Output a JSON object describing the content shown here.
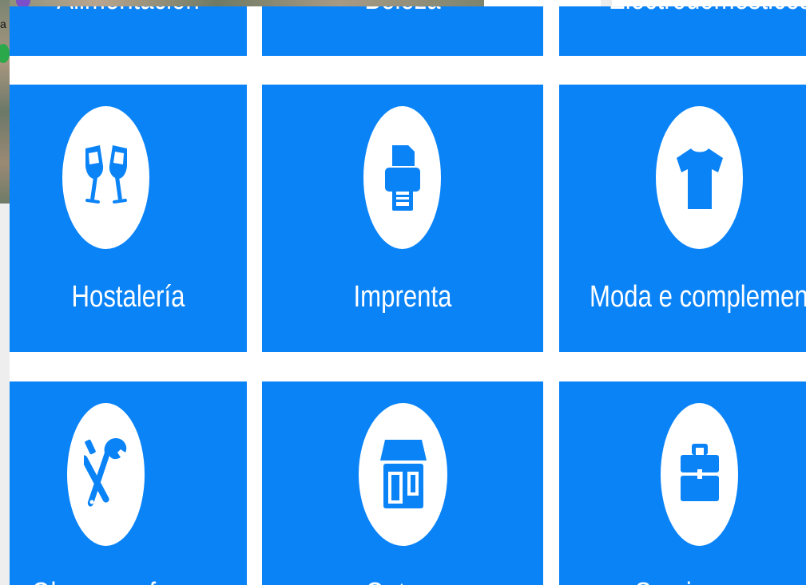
{
  "background_map": {
    "fragment_text": "a"
  },
  "tiles": {
    "row1": [
      {
        "label": "Alimentación"
      },
      {
        "label": "Beleza"
      },
      {
        "label": "Electrodomésticos"
      }
    ],
    "row2": [
      {
        "label": "Hostalería",
        "icon": "champagne-glasses-icon"
      },
      {
        "label": "Imprenta",
        "icon": "printer-icon"
      },
      {
        "label": "Moda e complementos",
        "icon": "tshirt-icon"
      }
    ],
    "row3": [
      {
        "label": "Obras e reformas",
        "icon": "tools-icon"
      },
      {
        "label": "Outros",
        "icon": "store-icon"
      },
      {
        "label": "Servizos",
        "icon": "toolbox-icon"
      }
    ]
  },
  "colors": {
    "tile_blue": "#0a83f7",
    "white": "#ffffff"
  }
}
